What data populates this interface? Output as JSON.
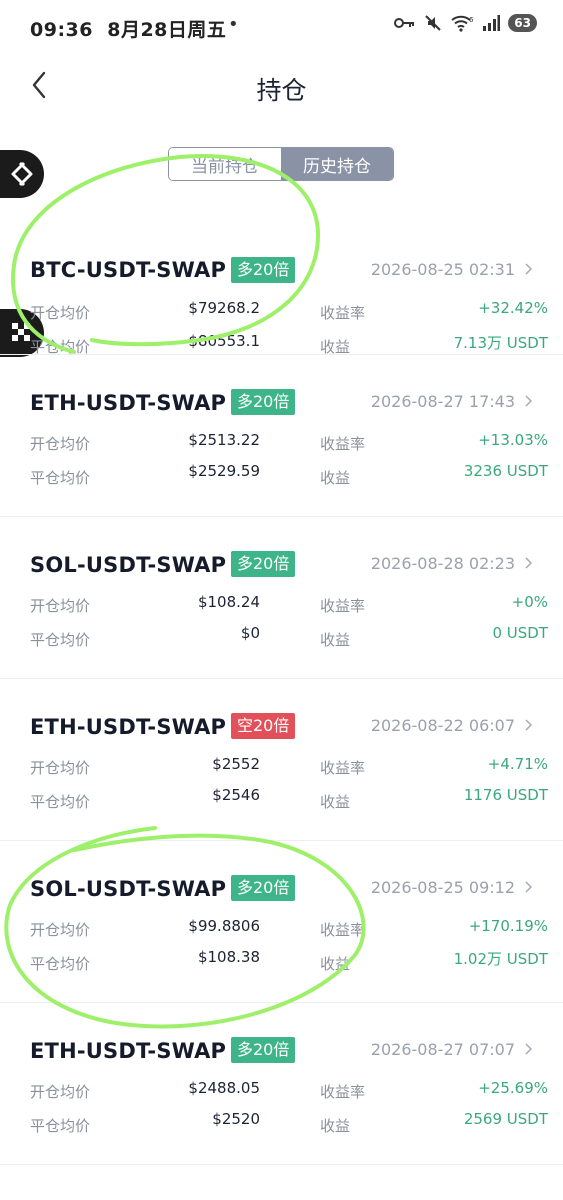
{
  "status_bar": {
    "time": "09:36",
    "date": "8月28日周五",
    "dot": "•",
    "battery": "63"
  },
  "header": {
    "title": "持仓"
  },
  "tabs": [
    {
      "label": "当前持仓",
      "active": false
    },
    {
      "label": "历史持仓",
      "active": true
    }
  ],
  "labels": {
    "open_avg": "开仓均价",
    "close_avg": "平仓均价",
    "yield_rate": "收益率",
    "profit": "收益"
  },
  "positions": [
    {
      "symbol": "BTC-USDT-SWAP",
      "badge": "多20倍",
      "side": "long",
      "time": "2026-08-25 02:31",
      "open_price": "$79268.2",
      "close_price": "$80553.1",
      "yield_rate": "+32.42%",
      "profit": "7.13万 USDT"
    },
    {
      "symbol": "ETH-USDT-SWAP",
      "badge": "多20倍",
      "side": "long",
      "time": "2026-08-27 17:43",
      "open_price": "$2513.22",
      "close_price": "$2529.59",
      "yield_rate": "+13.03%",
      "profit": "3236 USDT"
    },
    {
      "symbol": "SOL-USDT-SWAP",
      "badge": "多20倍",
      "side": "long",
      "time": "2026-08-28 02:23",
      "open_price": "$108.24",
      "close_price": "$0",
      "yield_rate": "+0%",
      "profit": "0 USDT"
    },
    {
      "symbol": "ETH-USDT-SWAP",
      "badge": "空20倍",
      "side": "short",
      "time": "2026-08-22 06:07",
      "open_price": "$2552",
      "close_price": "$2546",
      "yield_rate": "+4.71%",
      "profit": "1176 USDT"
    },
    {
      "symbol": "SOL-USDT-SWAP",
      "badge": "多20倍",
      "side": "long",
      "time": "2026-08-25 09:12",
      "open_price": "$99.8806",
      "close_price": "$108.38",
      "yield_rate": "+170.19%",
      "profit": "1.02万 USDT"
    },
    {
      "symbol": "ETH-USDT-SWAP",
      "badge": "多20倍",
      "side": "long",
      "time": "2026-08-27 07:07",
      "open_price": "$2488.05",
      "close_price": "$2520",
      "yield_rate": "+25.69%",
      "profit": "2569 USDT"
    }
  ],
  "colors": {
    "long": "#3db48a",
    "short": "#e2505a",
    "gain_text": "#3aa87e",
    "highlight_circle": "#9ef06a"
  }
}
